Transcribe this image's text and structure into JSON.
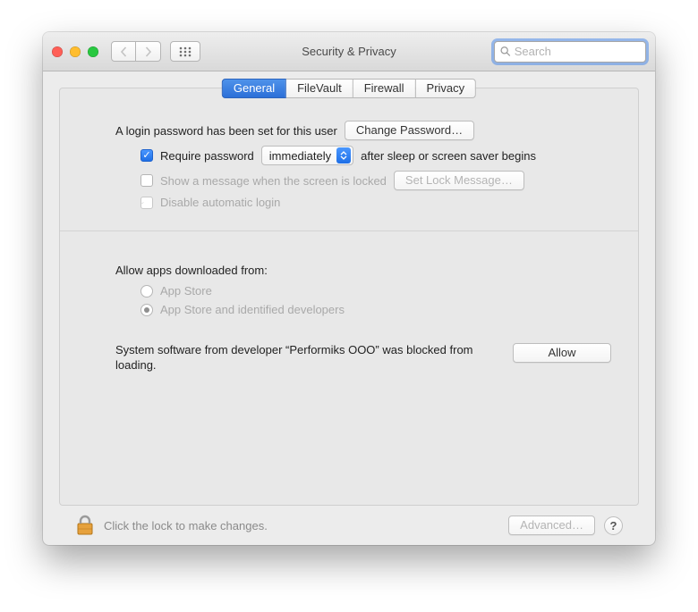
{
  "window": {
    "title": "Security & Privacy",
    "search_placeholder": "Search"
  },
  "tabs": [
    "General",
    "FileVault",
    "Firewall",
    "Privacy"
  ],
  "active_tab": "General",
  "general": {
    "login_password_text": "A login password has been set for this user",
    "change_password_btn": "Change Password…",
    "require_pw_label": "Require password",
    "require_pw_delay": "immediately",
    "require_pw_tail": "after sleep or screen saver begins",
    "show_message_label": "Show a message when the screen is locked",
    "set_lock_message_btn": "Set Lock Message…",
    "disable_auto_login_label": "Disable automatic login"
  },
  "download": {
    "heading": "Allow apps downloaded from:",
    "opt_appstore": "App Store",
    "opt_identified": "App Store and identified developers"
  },
  "blocked": {
    "text": "System software from developer “Performiks OOO” was blocked from loading.",
    "allow_btn": "Allow"
  },
  "footer": {
    "lock_hint": "Click the lock to make changes.",
    "advanced_btn": "Advanced…"
  }
}
